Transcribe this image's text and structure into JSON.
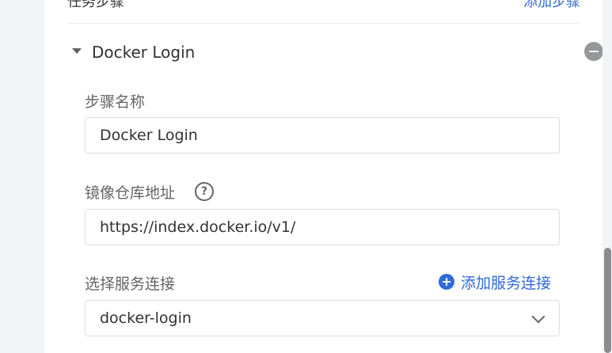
{
  "section": {
    "title": "任务步骤",
    "action_label": "添加步骤"
  },
  "step": {
    "title": "Docker Login",
    "fields": {
      "step_name": {
        "label": "步骤名称",
        "value": "Docker Login"
      },
      "registry_url": {
        "label": "镜像仓库地址",
        "value": "https://index.docker.io/v1/",
        "help": "?"
      },
      "service_connection": {
        "label": "选择服务连接",
        "add_label": "添加服务连接",
        "value": "docker-login"
      }
    }
  },
  "colors": {
    "accent": "#2f6bd8",
    "muted": "#969799",
    "border": "#dcdee0"
  }
}
